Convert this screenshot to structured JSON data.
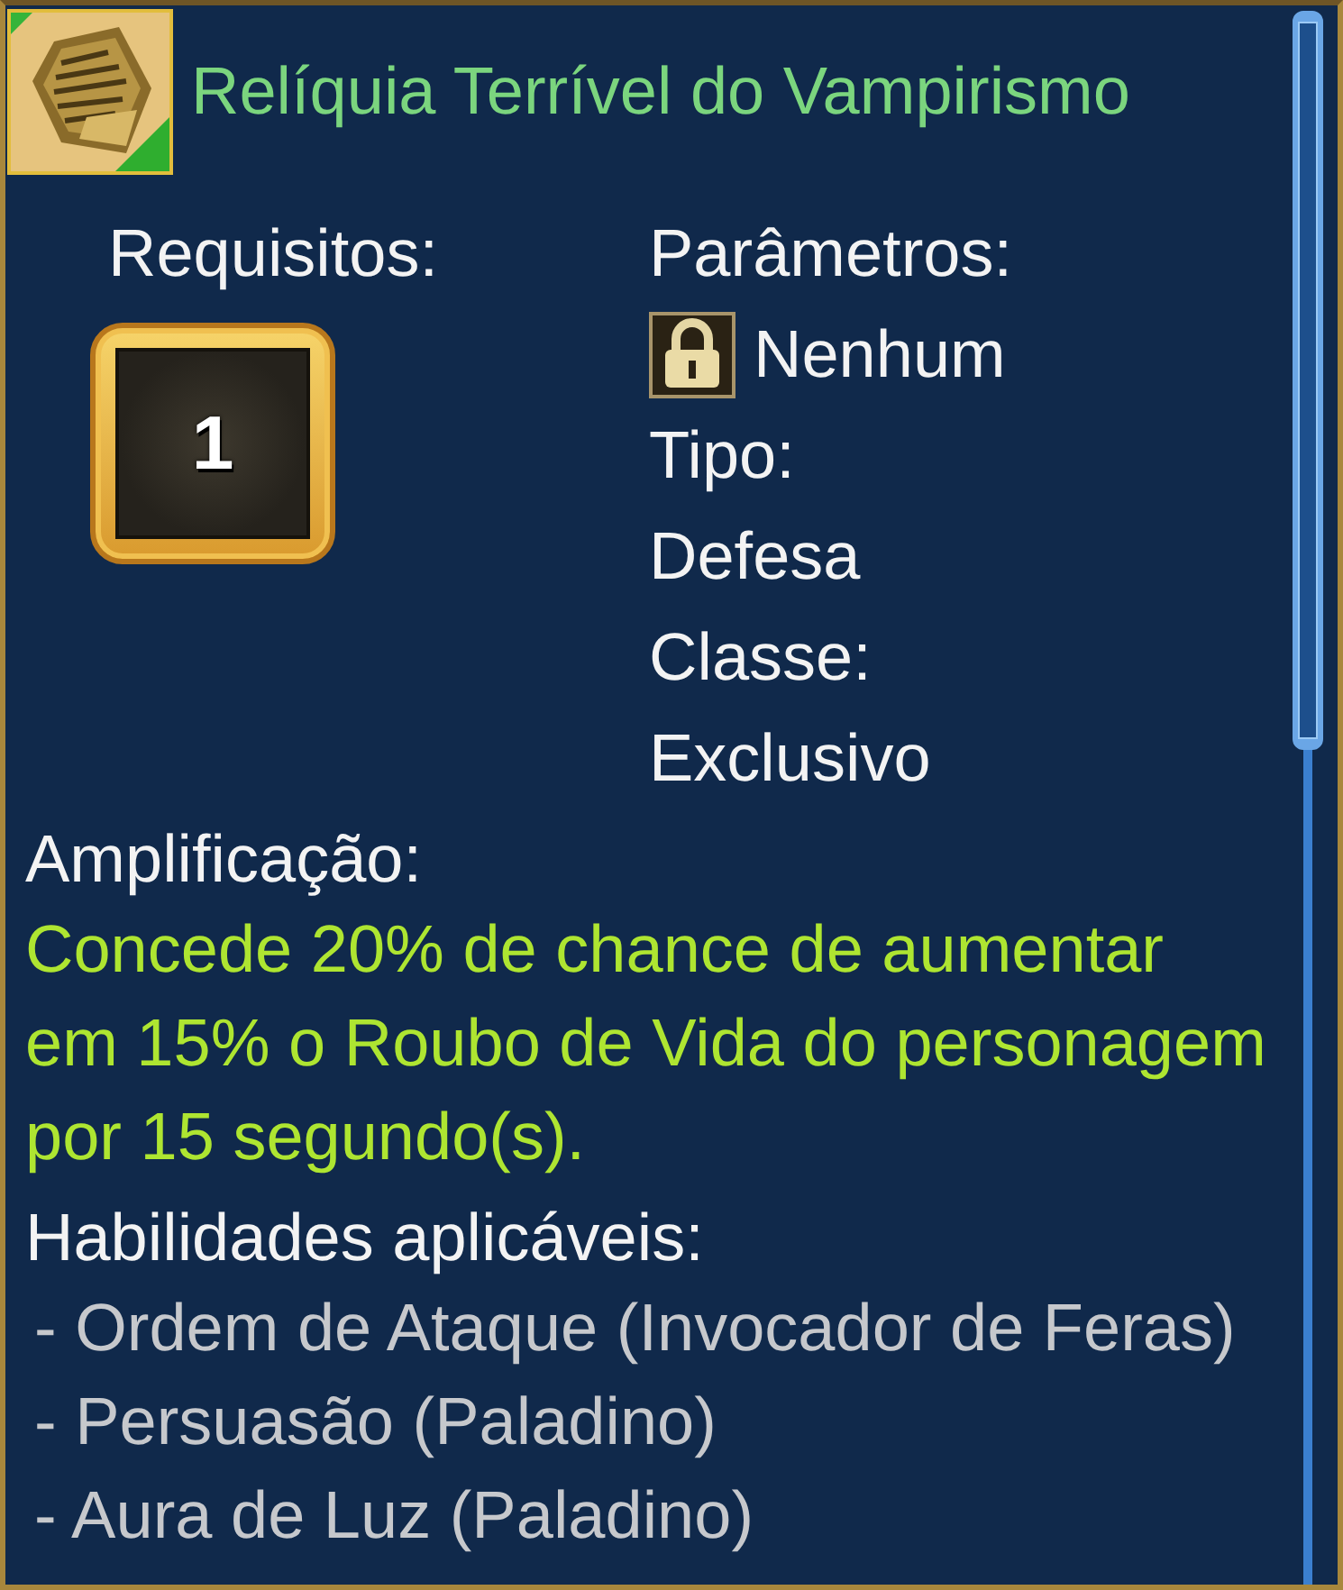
{
  "item": {
    "title": "Relíquia Terrível do Vampirismo"
  },
  "requirements": {
    "label": "Requisitos:",
    "value": "1"
  },
  "parameters": {
    "label": "Parâmetros:",
    "value": "Nenhum"
  },
  "fields": [
    {
      "label": "Tipo:",
      "value": "Defesa"
    },
    {
      "label": "Classe:",
      "value": "Exclusivo"
    }
  ],
  "amplification": {
    "label": "Amplificação:",
    "text": "Concede 20% de chance de aumentar em 15% o Roubo de Vida do personagem por 15 segundo(s)."
  },
  "skills": {
    "label": "Habilidades aplicáveis:",
    "items": [
      "- Ordem de Ataque (Invocador de Feras)",
      "- Persuasão (Paladino)",
      "- Aura de Luz (Paladino)"
    ]
  }
}
